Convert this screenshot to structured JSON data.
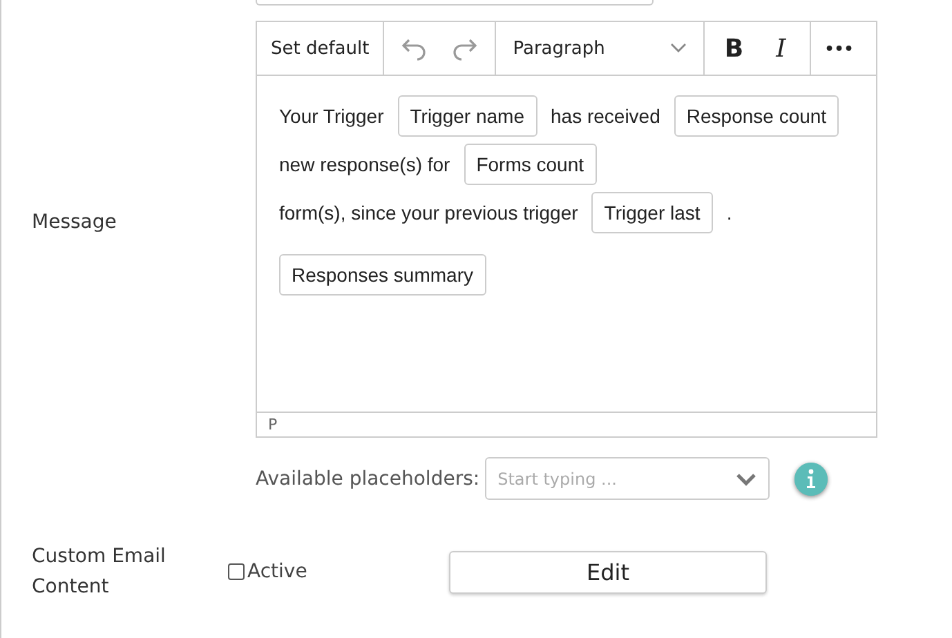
{
  "toolbar": {
    "set_default": "Set default",
    "block_format": "Paragraph",
    "bold": "B",
    "italic": "I",
    "more": "•••"
  },
  "message_label": "Message",
  "paragraphs": [
    {
      "segments": [
        {
          "kind": "text",
          "text": "Your Trigger"
        },
        {
          "kind": "chip",
          "text": "Trigger name"
        },
        {
          "kind": "text",
          "text": "has received"
        },
        {
          "kind": "chip",
          "text": "Response count"
        },
        {
          "kind": "text",
          "text": "new response(s) for"
        },
        {
          "kind": "chip",
          "text": "Forms count"
        },
        {
          "kind": "text",
          "text": "form(s), since your previous trigger"
        },
        {
          "kind": "chip",
          "text": "Trigger last"
        },
        {
          "kind": "text",
          "text": "."
        }
      ]
    },
    {
      "segments": [
        {
          "kind": "chip",
          "text": "Responses summary"
        }
      ]
    }
  ],
  "status_path": "P",
  "placeholders": {
    "label": "Available placeholders:",
    "placeholder": "Start typing ..."
  },
  "custom_email": {
    "label": "Custom Email Content",
    "checkbox_label": "Active",
    "checked": false,
    "button": "Edit"
  }
}
